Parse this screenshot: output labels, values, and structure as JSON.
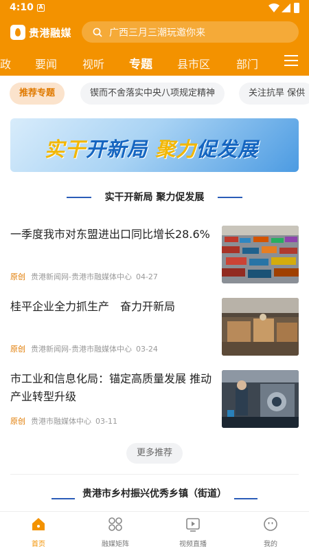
{
  "status": {
    "time": "4:10",
    "indicator": "A"
  },
  "app": {
    "name": "贵港融媒"
  },
  "search": {
    "placeholder": "广西三月三潮玩邀你来"
  },
  "channels": [
    "政",
    "要闻",
    "视听",
    "专题",
    "县市区",
    "部门"
  ],
  "active_channel": "专题",
  "subtabs": [
    "推荐专题",
    "锲而不舍落实中央八项规定精神",
    "关注抗旱 保供"
  ],
  "banner": {
    "part1": "实干",
    "part2": "开新局",
    "part3": "聚力",
    "part4": "促发展"
  },
  "section1": {
    "title": "实干开新局 聚力促发展"
  },
  "news": [
    {
      "title": "一季度我市对东盟进出口同比增长28.6%",
      "tag": "原创",
      "source": "贵港新闻网-贵港市融媒体中心",
      "date": "04-27",
      "image": "container-port-photo"
    },
    {
      "title": "桂平企业全力抓生产　奋力开新局",
      "tag": "原创",
      "source": "贵港新闻网-贵港市融媒体中心",
      "date": "03-24",
      "image": "wood-factory-photo"
    },
    {
      "title": "市工业和信息化局：锚定高质量发展 推动产业转型升级",
      "tag": "原创",
      "source": "贵港市融媒体中心",
      "date": "03-11",
      "image": "industrial-worker-photo"
    }
  ],
  "more_button": "更多推荐",
  "section2": {
    "title": "贵港市乡村振兴优秀乡镇（街道）"
  },
  "tabbar": [
    {
      "label": "首页",
      "icon": "home-icon",
      "active": true
    },
    {
      "label": "融媒矩阵",
      "icon": "grid-icon",
      "active": false
    },
    {
      "label": "视频直播",
      "icon": "video-icon",
      "active": false
    },
    {
      "label": "我的",
      "icon": "profile-icon",
      "active": false
    }
  ],
  "colors": {
    "brand": "#f39200",
    "accent_blue": "#2a5cb8",
    "tag_orange": "#e07a00"
  }
}
